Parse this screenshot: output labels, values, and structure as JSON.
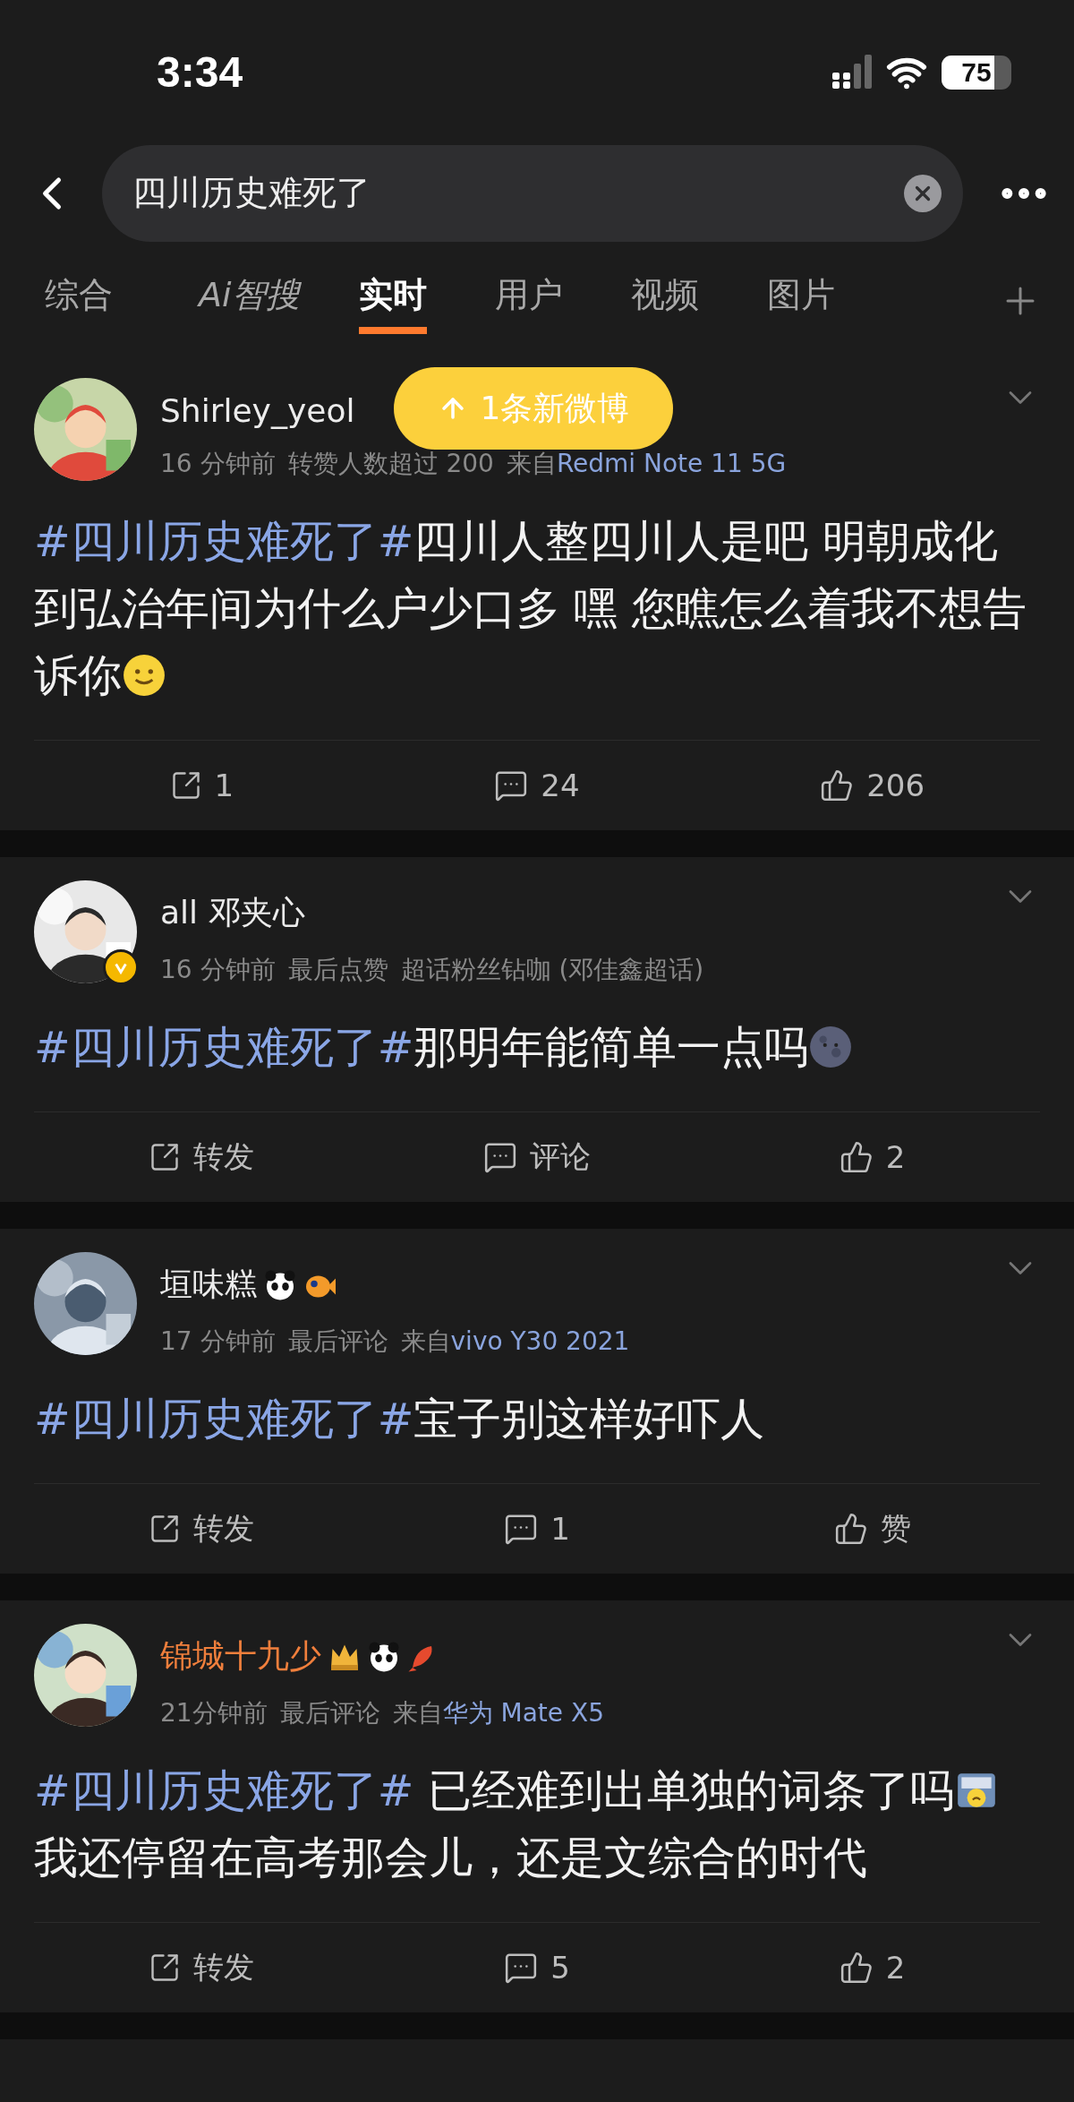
{
  "status_bar": {
    "time": "3:34",
    "battery": "75"
  },
  "search": {
    "value": "四川历史难死了"
  },
  "tabs": [
    {
      "label": "综合",
      "selected": false,
      "kind": "text"
    },
    {
      "label": "Ai智搜",
      "selected": false,
      "kind": "ai"
    },
    {
      "label": "实时",
      "selected": true,
      "kind": "text"
    },
    {
      "label": "用户",
      "selected": false,
      "kind": "text"
    },
    {
      "label": "视频",
      "selected": false,
      "kind": "text"
    },
    {
      "label": "图片",
      "selected": false,
      "kind": "text"
    }
  ],
  "new_posts_toast": "1条新微博",
  "posts": [
    {
      "author": "Shirley_yeol",
      "vip": false,
      "verified": false,
      "time": "16 分钟前",
      "note": "转赞人数超过 200",
      "source_prefix": "来自",
      "source": "Redmi Note 11 5G",
      "body": [
        {
          "kind": "hashtag",
          "text": "#四川历史难死了#"
        },
        {
          "kind": "text",
          "text": "四川人整四川人是吧 明朝成化到弘治年间为什么户少口多 嘿 您瞧怎么着我不想告诉你"
        },
        {
          "kind": "smile"
        }
      ],
      "actions": {
        "repost": "1",
        "comment": "24",
        "like": "206"
      }
    },
    {
      "author": "all 邓夹心",
      "vip": false,
      "verified": true,
      "time": "16 分钟前",
      "note": "最后点赞",
      "extra": "超话粉丝钻咖 (邓佳鑫超话)",
      "body": [
        {
          "kind": "hashtag",
          "text": "#四川历史难死了#"
        },
        {
          "kind": "text",
          "text": "那明年能简单一点吗"
        },
        {
          "kind": "moon"
        }
      ],
      "actions": {
        "repost": "转发",
        "comment": "评论",
        "like": "2"
      }
    },
    {
      "author": "垣味糕",
      "vip": false,
      "verified": false,
      "badges": [
        {
          "kind": "panda"
        },
        {
          "kind": "fish"
        }
      ],
      "time": "17 分钟前",
      "note": "最后评论",
      "source_prefix": "来自",
      "source": "vivo Y30 2021",
      "body": [
        {
          "kind": "hashtag",
          "text": "#四川历史难死了#"
        },
        {
          "kind": "text",
          "text": "宝子别这样好吓人"
        }
      ],
      "actions": {
        "repost": "转发",
        "comment": "1",
        "like": "赞"
      }
    },
    {
      "author": "锦城十九少",
      "vip": true,
      "verified": false,
      "badges": [
        {
          "kind": "crown"
        },
        {
          "kind": "panda"
        },
        {
          "kind": "koi"
        }
      ],
      "time": "21分钟前",
      "note": "最后评论",
      "source_prefix": "来自",
      "source": "华为 Mate X5",
      "body": [
        {
          "kind": "hashtag",
          "text": "#四川历史难死了#"
        },
        {
          "kind": "text",
          "text": " 已经难到出单独的词条了吗"
        },
        {
          "kind": "sticker"
        },
        {
          "kind": "text",
          "text": "我还停留在高考那会儿，还是文综合的时代"
        }
      ],
      "actions": {
        "repost": "转发",
        "comment": "5",
        "like": "2"
      }
    }
  ]
}
